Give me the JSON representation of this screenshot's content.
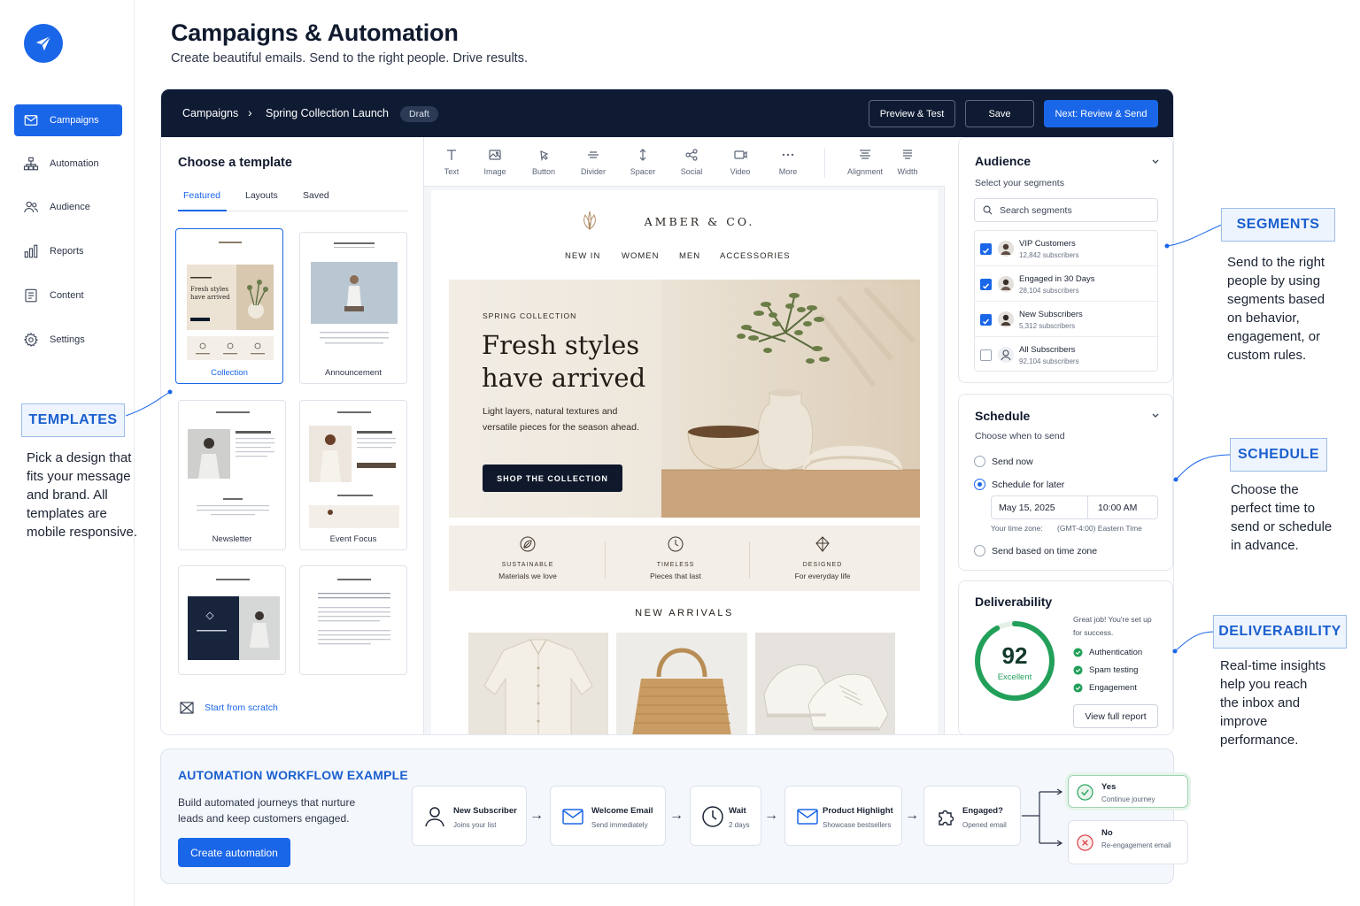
{
  "header": {
    "title": "Campaigns & Automation",
    "subtitle": "Create beautiful emails. Send to the right people. Drive results."
  },
  "sidebar": {
    "items": [
      {
        "label": "Campaigns",
        "icon": "mail-icon",
        "active": true
      },
      {
        "label": "Automation",
        "icon": "workflow-icon"
      },
      {
        "label": "Audience",
        "icon": "users-icon"
      },
      {
        "label": "Reports",
        "icon": "bar-chart-icon"
      },
      {
        "label": "Content",
        "icon": "document-icon"
      },
      {
        "label": "Settings",
        "icon": "gear-icon"
      }
    ]
  },
  "topbar": {
    "breadcrumb_root": "Campaigns",
    "breadcrumb_current": "Spring Collection Launch",
    "status_badge": "Draft",
    "preview_label": "Preview & Test",
    "save_label": "Save",
    "next_label": "Next: Review & Send"
  },
  "templates": {
    "heading": "Choose a template",
    "tabs": [
      "Featured",
      "Layouts",
      "Saved"
    ],
    "active_tab": "Featured",
    "cards": [
      "Collection",
      "Announcement",
      "Newsletter",
      "Event Focus"
    ],
    "selected": "Collection",
    "thumb_title_1": "Fresh styles",
    "thumb_title_2": "have arrived",
    "start_scratch": "Start from scratch"
  },
  "toolbar": {
    "tools": [
      "Text",
      "Image",
      "Button",
      "Divider",
      "Spacer",
      "Social",
      "Video",
      "More",
      "Alignment",
      "Width"
    ]
  },
  "email": {
    "brand": "AMBER & CO.",
    "nav": [
      "NEW IN",
      "WOMEN",
      "MEN",
      "ACCESSORIES"
    ],
    "hero_eyebrow": "SPRING COLLECTION",
    "hero_title": "Fresh styles have arrived",
    "hero_body": "Light layers, natural textures and versatile pieces for the season ahead.",
    "hero_button": "SHOP THE COLLECTION",
    "features": [
      {
        "title": "SUSTAINABLE",
        "sub": "Materials we love",
        "icon": "leaf-icon"
      },
      {
        "title": "TIMELESS",
        "sub": "Pieces that last",
        "icon": "clock-icon"
      },
      {
        "title": "DESIGNED",
        "sub": "For everyday life",
        "icon": "diamond-icon"
      }
    ],
    "arrivals_heading": "NEW ARRIVALS",
    "products": [
      "linen-shirt",
      "woven-tote",
      "white-sneakers"
    ]
  },
  "audience": {
    "title": "Audience",
    "subtitle": "Select your segments",
    "search_placeholder": "Search segments",
    "segments": [
      {
        "name": "VIP Customers",
        "count": "12,842 subscribers",
        "checked": true
      },
      {
        "name": "Engaged in 30 Days",
        "count": "28,104 subscribers",
        "checked": true
      },
      {
        "name": "New Subscribers",
        "count": "5,312 subscribers",
        "checked": true
      },
      {
        "name": "All Subscribers",
        "count": "92,104 subscribers",
        "checked": false
      }
    ]
  },
  "schedule": {
    "title": "Schedule",
    "subtitle": "Choose when to send",
    "options": [
      "Send now",
      "Schedule for later",
      "Send based on time zone"
    ],
    "selected": "Schedule for later",
    "date": "May 15, 2025",
    "time": "10:00 AM",
    "tz_label": "Your time zone:",
    "tz_value": "(GMT-4:00) Eastern Time"
  },
  "deliverability": {
    "title": "Deliverability",
    "score": "92",
    "score_value": 0.92,
    "score_label": "Excellent",
    "message": "Great job! You're set up for success.",
    "checks": [
      "Authentication",
      "Spam testing",
      "Engagement"
    ],
    "button": "View full report"
  },
  "callouts": {
    "templates": {
      "title": "TEMPLATES",
      "text": "Pick a design that fits your message and brand. All templates are mobile responsive."
    },
    "segments": {
      "title": "SEGMENTS",
      "text": "Send to the right people by using segments based on behavior, engagement, or custom rules."
    },
    "schedule": {
      "title": "SCHEDULE",
      "text": "Choose the perfect time to send or schedule in advance."
    },
    "deliverability": {
      "title": "DELIVERABILITY",
      "text": "Real-time insights help you reach the inbox and improve performance."
    }
  },
  "automation": {
    "title": "AUTOMATION WORKFLOW EXAMPLE",
    "subtitle": "Build automated journeys that nurture leads and keep customers engaged.",
    "button": "Create automation",
    "steps": [
      {
        "title": "New Subscriber",
        "sub": "Joins your list",
        "icon": "user-icon"
      },
      {
        "title": "Welcome Email",
        "sub": "Send immediately",
        "icon": "mail-icon"
      },
      {
        "title": "Wait",
        "sub": "2 days",
        "icon": "clock-icon"
      },
      {
        "title": "Product Highlight",
        "sub": "Showcase bestsellers",
        "icon": "mail-icon"
      },
      {
        "title": "Engaged?",
        "sub": "Opened email",
        "icon": "puzzle-icon"
      }
    ],
    "outcomes": [
      {
        "title": "Yes",
        "sub": "Continue journey"
      },
      {
        "title": "No",
        "sub": "Re-engagement email"
      }
    ]
  },
  "colors": {
    "accent": "#1a66e8",
    "navy": "#0f1b33",
    "success": "#22a05a",
    "danger": "#d8393e"
  }
}
